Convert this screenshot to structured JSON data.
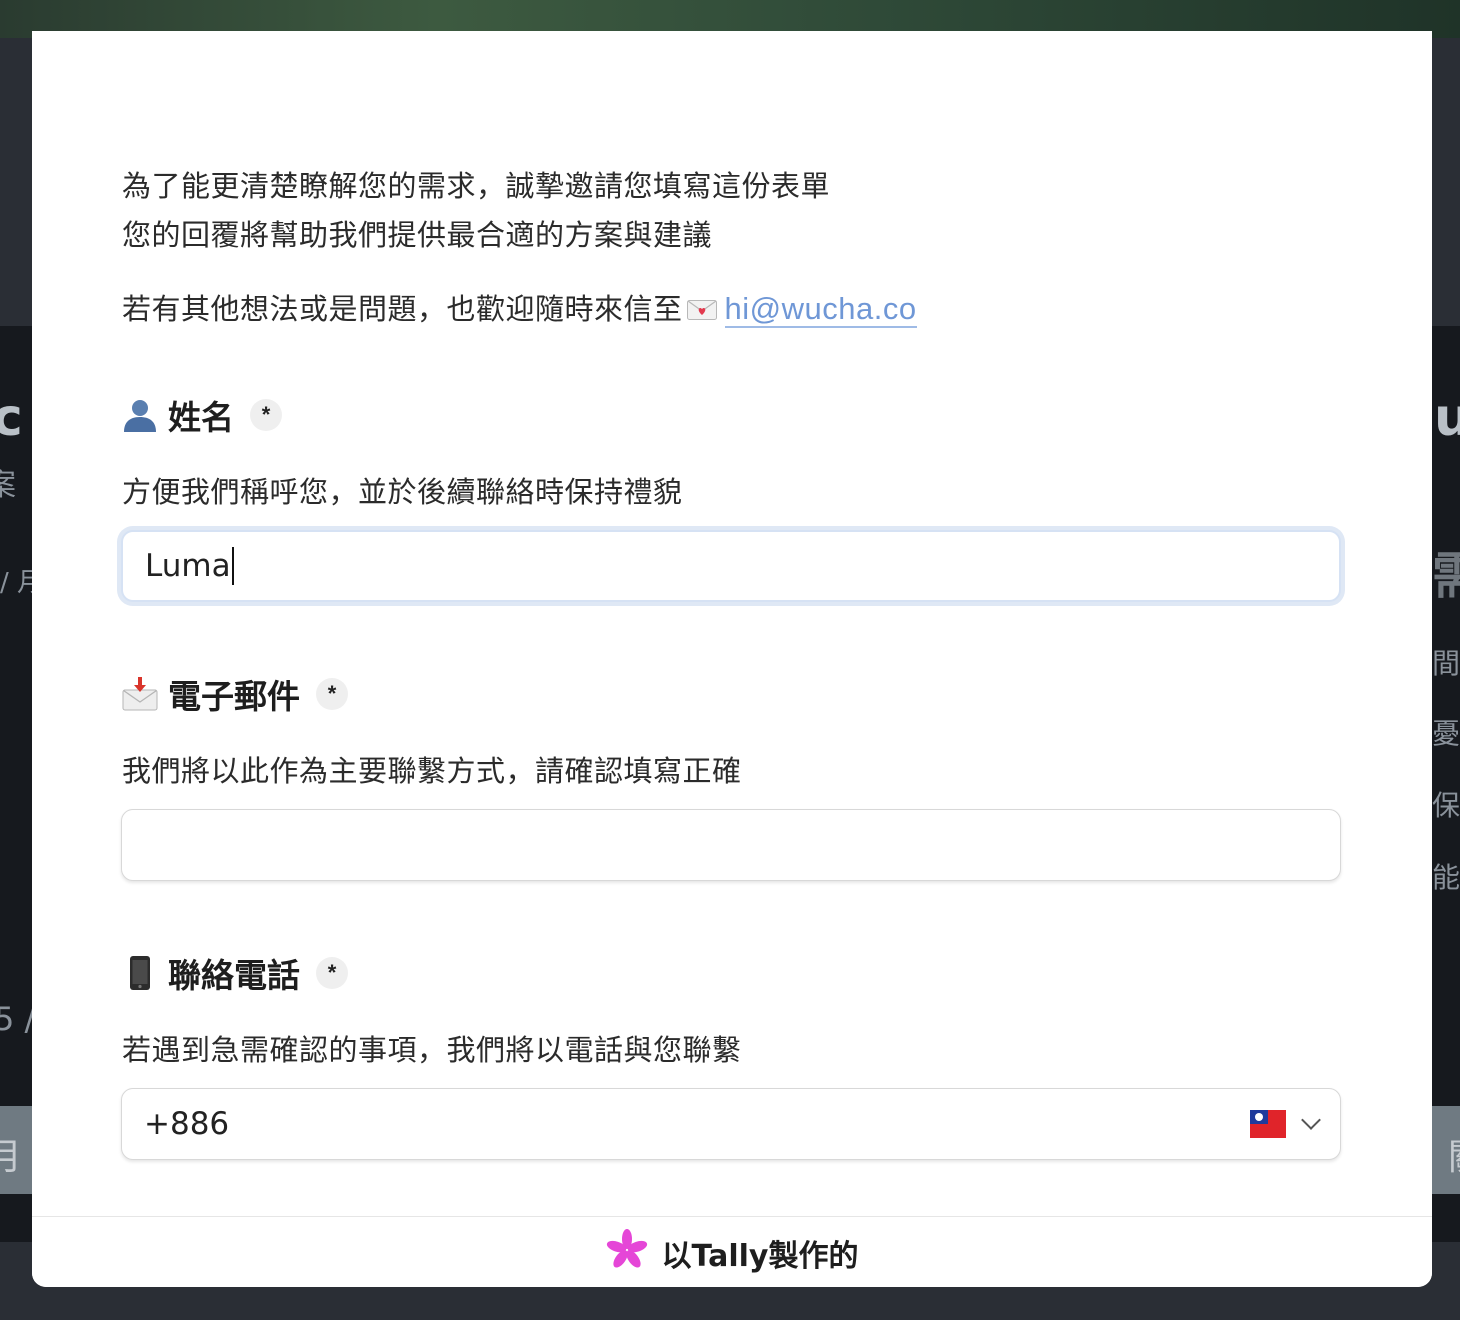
{
  "background": {
    "left_fragments": [
      "c",
      "案",
      "/ 月",
      "5 /",
      "月"
    ],
    "right_fragments": [
      "u",
      "需",
      "間",
      "憂",
      "保",
      "能",
      "關"
    ]
  },
  "form": {
    "intro": {
      "line1": "為了能更清楚瞭解您的需求，誠摯邀請您填寫這份表單",
      "line2": "您的回覆將幫助我們提供最合適的方案與建議",
      "line3_prefix": "若有其他想法或是問題，也歡迎隨時來信至",
      "line3_icon": "love-letter-icon",
      "email": "hi@wucha.co"
    },
    "fields": {
      "name": {
        "icon": "bust-silhouette-icon",
        "label": "姓名",
        "required_mark": "*",
        "description": "方便我們稱呼您，並於後續聯絡時保持禮貌",
        "value": "Luma"
      },
      "email": {
        "icon": "envelope-with-arrow-icon",
        "label": "電子郵件",
        "required_mark": "*",
        "description": "我們將以此作為主要聯繫方式，請確認填寫正確",
        "value": ""
      },
      "phone": {
        "icon": "mobile-phone-icon",
        "label": "聯絡電話",
        "required_mark": "*",
        "description": "若遇到急需確認的事項，我們將以電話與您聯繫",
        "value": "+886",
        "country_flag": "taiwan-flag-icon"
      }
    }
  },
  "footer": {
    "logo_icon": "tally-asterisk-icon",
    "logo_color": "#e546d7",
    "text": "以Tally製作的"
  },
  "colors": {
    "link": "#6f97d6",
    "focus_ring": "#dfe8f5"
  }
}
